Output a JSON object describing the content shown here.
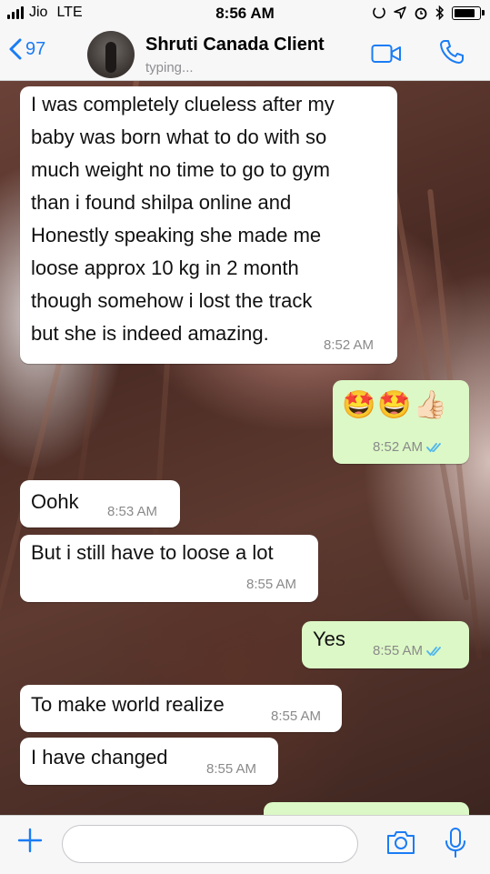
{
  "status_bar": {
    "carrier": "Jio",
    "network": "LTE",
    "time": "8:56 AM"
  },
  "header": {
    "back_count": "97",
    "contact_name": "Shruti Canada Client",
    "contact_status": "typing..."
  },
  "colors": {
    "accent": "#1a7cf5",
    "incoming_bubble": "#ffffff",
    "outgoing_bubble": "#dcf8c6",
    "read_tick": "#4fb6ec"
  },
  "messages": [
    {
      "direction": "incoming",
      "text": "I was completely clueless after my\nbaby was born what to do with so\nmuch weight no time to go to gym\nthan i found shilpa online and\nHonestly speaking she made me\nloose approx 10 kg in 2 month\nthough somehow i lost the track\nbut she is indeed amazing.",
      "time": "8:52 AM"
    },
    {
      "direction": "outgoing",
      "text": "🤩🤩👍🏻",
      "time": "8:52 AM",
      "read": true
    },
    {
      "direction": "incoming",
      "text": "Oohk",
      "time": "8:53 AM"
    },
    {
      "direction": "incoming",
      "text": "But i still have to loose a lot",
      "time": "8:55 AM"
    },
    {
      "direction": "outgoing",
      "text": "Yes",
      "time": "8:55 AM",
      "read": true
    },
    {
      "direction": "incoming",
      "text": "To make world realize",
      "time": "8:55 AM"
    },
    {
      "direction": "incoming",
      "text": "I have changed",
      "time": "8:55 AM"
    }
  ],
  "input": {
    "placeholder": ""
  },
  "icons": [
    "signal-icon",
    "alarm-icon",
    "bluetooth-icon",
    "battery-icon",
    "back-chevron-icon",
    "video-call-icon",
    "phone-call-icon",
    "plus-icon",
    "camera-icon",
    "mic-icon",
    "double-check-icon"
  ]
}
